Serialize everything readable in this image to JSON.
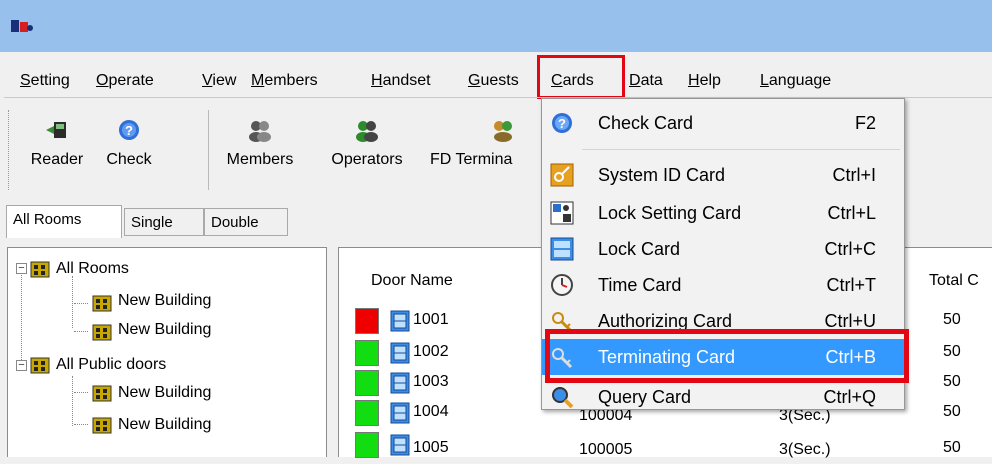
{
  "menu": [
    "Setting",
    "Operate",
    "View",
    "Members",
    "Handset",
    "Guests",
    "Cards",
    "Data",
    "Help",
    "Language"
  ],
  "toolbar": {
    "reader": "Reader",
    "check": "Check",
    "members": "Members",
    "operators": "Operators",
    "fd_terminal": "FD Termina"
  },
  "tabs": [
    "All Rooms",
    "Single",
    "Double"
  ],
  "tree": {
    "all_rooms": "All Rooms",
    "building1": "New Building",
    "building2": "New Building",
    "all_public": "All Public doors",
    "building3": "New Building",
    "building4": "New Building"
  },
  "grid": {
    "columns": [
      "Door Name",
      "Total C"
    ],
    "rows": [
      {
        "door": "1001",
        "status": "#ee0000",
        "total": "50"
      },
      {
        "door": "1002",
        "status": "#11dd11",
        "total": "50"
      },
      {
        "door": "1003",
        "status": "#11dd11",
        "total": "50"
      },
      {
        "door": "1004",
        "status": "#11dd11",
        "id": "100004",
        "time": "3(Sec.)",
        "total": "50"
      },
      {
        "door": "1005",
        "status": "#11dd11",
        "id": "100005",
        "time": "3(Sec.)",
        "total": "50"
      }
    ]
  },
  "cards_menu": [
    {
      "label": "Check Card",
      "key": "F2",
      "icon": "check-card-icon"
    },
    {
      "label": "System ID Card",
      "key": "Ctrl+I",
      "icon": "system-id-card-icon"
    },
    {
      "label": "Lock Setting Card",
      "key": "Ctrl+L",
      "icon": "lock-setting-card-icon"
    },
    {
      "label": "Lock Card",
      "key": "Ctrl+C",
      "icon": "lock-card-icon"
    },
    {
      "label": "Time Card",
      "key": "Ctrl+T",
      "icon": "time-card-icon"
    },
    {
      "label": "Authorizing Card",
      "key": "Ctrl+U",
      "icon": "authorizing-card-icon"
    },
    {
      "label": "Terminating Card",
      "key": "Ctrl+B",
      "icon": "terminating-card-icon"
    },
    {
      "label": "Query Card",
      "key": "Ctrl+Q",
      "icon": "query-card-icon"
    }
  ],
  "colors": {
    "highlight": "#3399ff",
    "annotation_red": "#e30613",
    "titlebar": "#97c1ec"
  }
}
